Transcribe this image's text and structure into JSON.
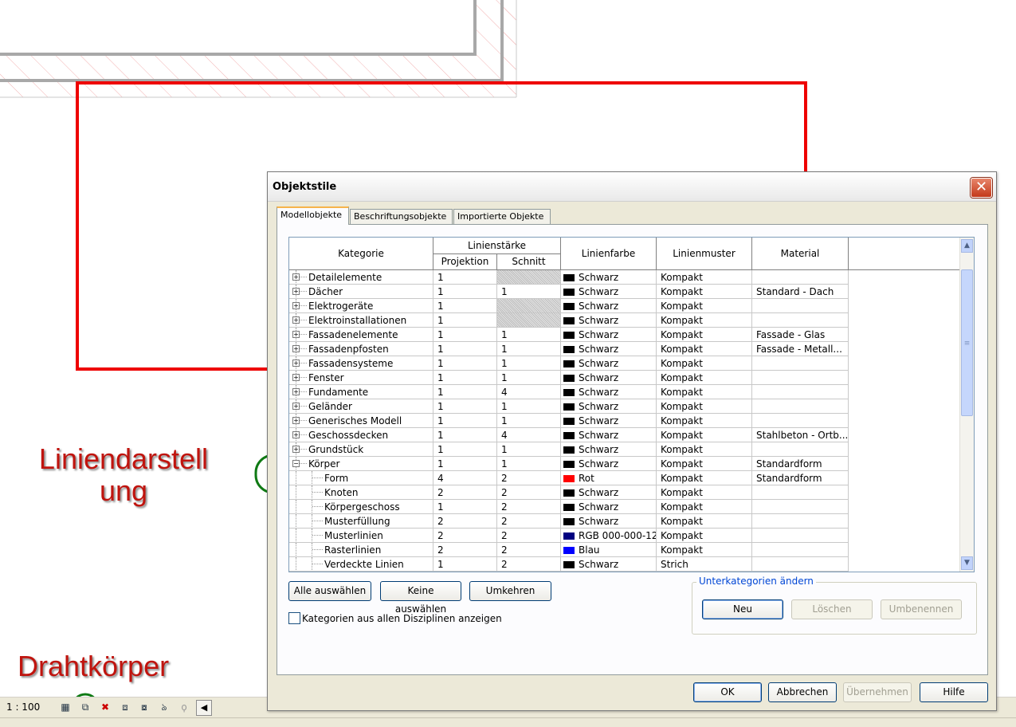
{
  "annotations": {
    "liniendarstellung_line1": "Liniendarstell",
    "liniendarstellung_line2": "ung",
    "drahtkoerper": "Drahtkörper"
  },
  "statusbar": {
    "scale": "1 : 100"
  },
  "dialog": {
    "title": "Objektstile",
    "close_glyph": "✕",
    "tabs": [
      "Modellobjekte",
      "Beschriftungsobjekte",
      "Importierte Objekte"
    ],
    "headers": {
      "kategorie": "Kategorie",
      "linienstaerke": "Linienstärke",
      "projektion": "Projektion",
      "schnitt": "Schnitt",
      "linienfarbe": "Linienfarbe",
      "linienmuster": "Linienmuster",
      "material": "Material"
    },
    "rows": [
      {
        "cat": "Detailelemente",
        "proj": "1",
        "schnitt": "",
        "color": "Schwarz",
        "swatch": "#000000",
        "muster": "Kompakt",
        "material": "",
        "level": 0,
        "expander": "+",
        "hatch": true
      },
      {
        "cat": "Dächer",
        "proj": "1",
        "schnitt": "1",
        "color": "Schwarz",
        "swatch": "#000000",
        "muster": "Kompakt",
        "material": "Standard - Dach",
        "level": 0,
        "expander": "+",
        "hatch": false
      },
      {
        "cat": "Elektrogeräte",
        "proj": "1",
        "schnitt": "",
        "color": "Schwarz",
        "swatch": "#000000",
        "muster": "Kompakt",
        "material": "",
        "level": 0,
        "expander": "+",
        "hatch": true
      },
      {
        "cat": "Elektroinstallationen",
        "proj": "1",
        "schnitt": "",
        "color": "Schwarz",
        "swatch": "#000000",
        "muster": "Kompakt",
        "material": "",
        "level": 0,
        "expander": "+",
        "hatch": true
      },
      {
        "cat": "Fassadenelemente",
        "proj": "1",
        "schnitt": "1",
        "color": "Schwarz",
        "swatch": "#000000",
        "muster": "Kompakt",
        "material": "Fassade - Glas",
        "level": 0,
        "expander": "+",
        "hatch": false
      },
      {
        "cat": "Fassadenpfosten",
        "proj": "1",
        "schnitt": "1",
        "color": "Schwarz",
        "swatch": "#000000",
        "muster": "Kompakt",
        "material": "Fassade - Metall...",
        "level": 0,
        "expander": "+",
        "hatch": false
      },
      {
        "cat": "Fassadensysteme",
        "proj": "1",
        "schnitt": "1",
        "color": "Schwarz",
        "swatch": "#000000",
        "muster": "Kompakt",
        "material": "",
        "level": 0,
        "expander": "+",
        "hatch": false
      },
      {
        "cat": "Fenster",
        "proj": "1",
        "schnitt": "1",
        "color": "Schwarz",
        "swatch": "#000000",
        "muster": "Kompakt",
        "material": "",
        "level": 0,
        "expander": "+",
        "hatch": false
      },
      {
        "cat": "Fundamente",
        "proj": "1",
        "schnitt": "4",
        "color": "Schwarz",
        "swatch": "#000000",
        "muster": "Kompakt",
        "material": "",
        "level": 0,
        "expander": "+",
        "hatch": false
      },
      {
        "cat": "Geländer",
        "proj": "1",
        "schnitt": "1",
        "color": "Schwarz",
        "swatch": "#000000",
        "muster": "Kompakt",
        "material": "",
        "level": 0,
        "expander": "+",
        "hatch": false
      },
      {
        "cat": "Generisches Modell",
        "proj": "1",
        "schnitt": "1",
        "color": "Schwarz",
        "swatch": "#000000",
        "muster": "Kompakt",
        "material": "",
        "level": 0,
        "expander": "+",
        "hatch": false
      },
      {
        "cat": "Geschossdecken",
        "proj": "1",
        "schnitt": "4",
        "color": "Schwarz",
        "swatch": "#000000",
        "muster": "Kompakt",
        "material": "Stahlbeton - Ortb...",
        "level": 0,
        "expander": "+",
        "hatch": false
      },
      {
        "cat": "Grundstück",
        "proj": "1",
        "schnitt": "1",
        "color": "Schwarz",
        "swatch": "#000000",
        "muster": "Kompakt",
        "material": "",
        "level": 0,
        "expander": "+",
        "hatch": false
      },
      {
        "cat": "Körper",
        "proj": "1",
        "schnitt": "1",
        "color": "Schwarz",
        "swatch": "#000000",
        "muster": "Kompakt",
        "material": "Standardform",
        "level": 0,
        "expander": "−",
        "hatch": false
      },
      {
        "cat": "Form",
        "proj": "4",
        "schnitt": "2",
        "color": "Rot",
        "swatch": "#ff0000",
        "muster": "Kompakt",
        "material": "Standardform",
        "level": 1,
        "expander": "",
        "hatch": false
      },
      {
        "cat": "Knoten",
        "proj": "2",
        "schnitt": "2",
        "color": "Schwarz",
        "swatch": "#000000",
        "muster": "Kompakt",
        "material": "",
        "level": 1,
        "expander": "",
        "hatch": false
      },
      {
        "cat": "Körpergeschoss",
        "proj": "1",
        "schnitt": "2",
        "color": "Schwarz",
        "swatch": "#000000",
        "muster": "Kompakt",
        "material": "",
        "level": 1,
        "expander": "",
        "hatch": false
      },
      {
        "cat": "Musterfüllung",
        "proj": "2",
        "schnitt": "2",
        "color": "Schwarz",
        "swatch": "#000000",
        "muster": "Kompakt",
        "material": "",
        "level": 1,
        "expander": "",
        "hatch": false
      },
      {
        "cat": "Musterlinien",
        "proj": "2",
        "schnitt": "2",
        "color": "RGB 000-000-12",
        "swatch": "#000080",
        "muster": "Kompakt",
        "material": "",
        "level": 1,
        "expander": "",
        "hatch": false
      },
      {
        "cat": "Rasterlinien",
        "proj": "2",
        "schnitt": "2",
        "color": "Blau",
        "swatch": "#0000ff",
        "muster": "Kompakt",
        "material": "",
        "level": 1,
        "expander": "",
        "hatch": false
      },
      {
        "cat": "Verdeckte Linien",
        "proj": "1",
        "schnitt": "2",
        "color": "Schwarz",
        "swatch": "#000000",
        "muster": "Strich",
        "material": "",
        "level": 1,
        "expander": "",
        "hatch": false
      }
    ],
    "buttons": {
      "select_all": "Alle auswählen",
      "select_none": "Keine auswählen",
      "invert": "Umkehren",
      "subcat_group": "Unterkategorien ändern",
      "new": "Neu",
      "delete": "Löschen",
      "rename": "Umbenennen",
      "ok": "OK",
      "cancel": "Abbrechen",
      "apply": "Übernehmen",
      "help": "Hilfe"
    },
    "checkbox_label": "Kategorien aus allen Disziplinen anzeigen"
  }
}
